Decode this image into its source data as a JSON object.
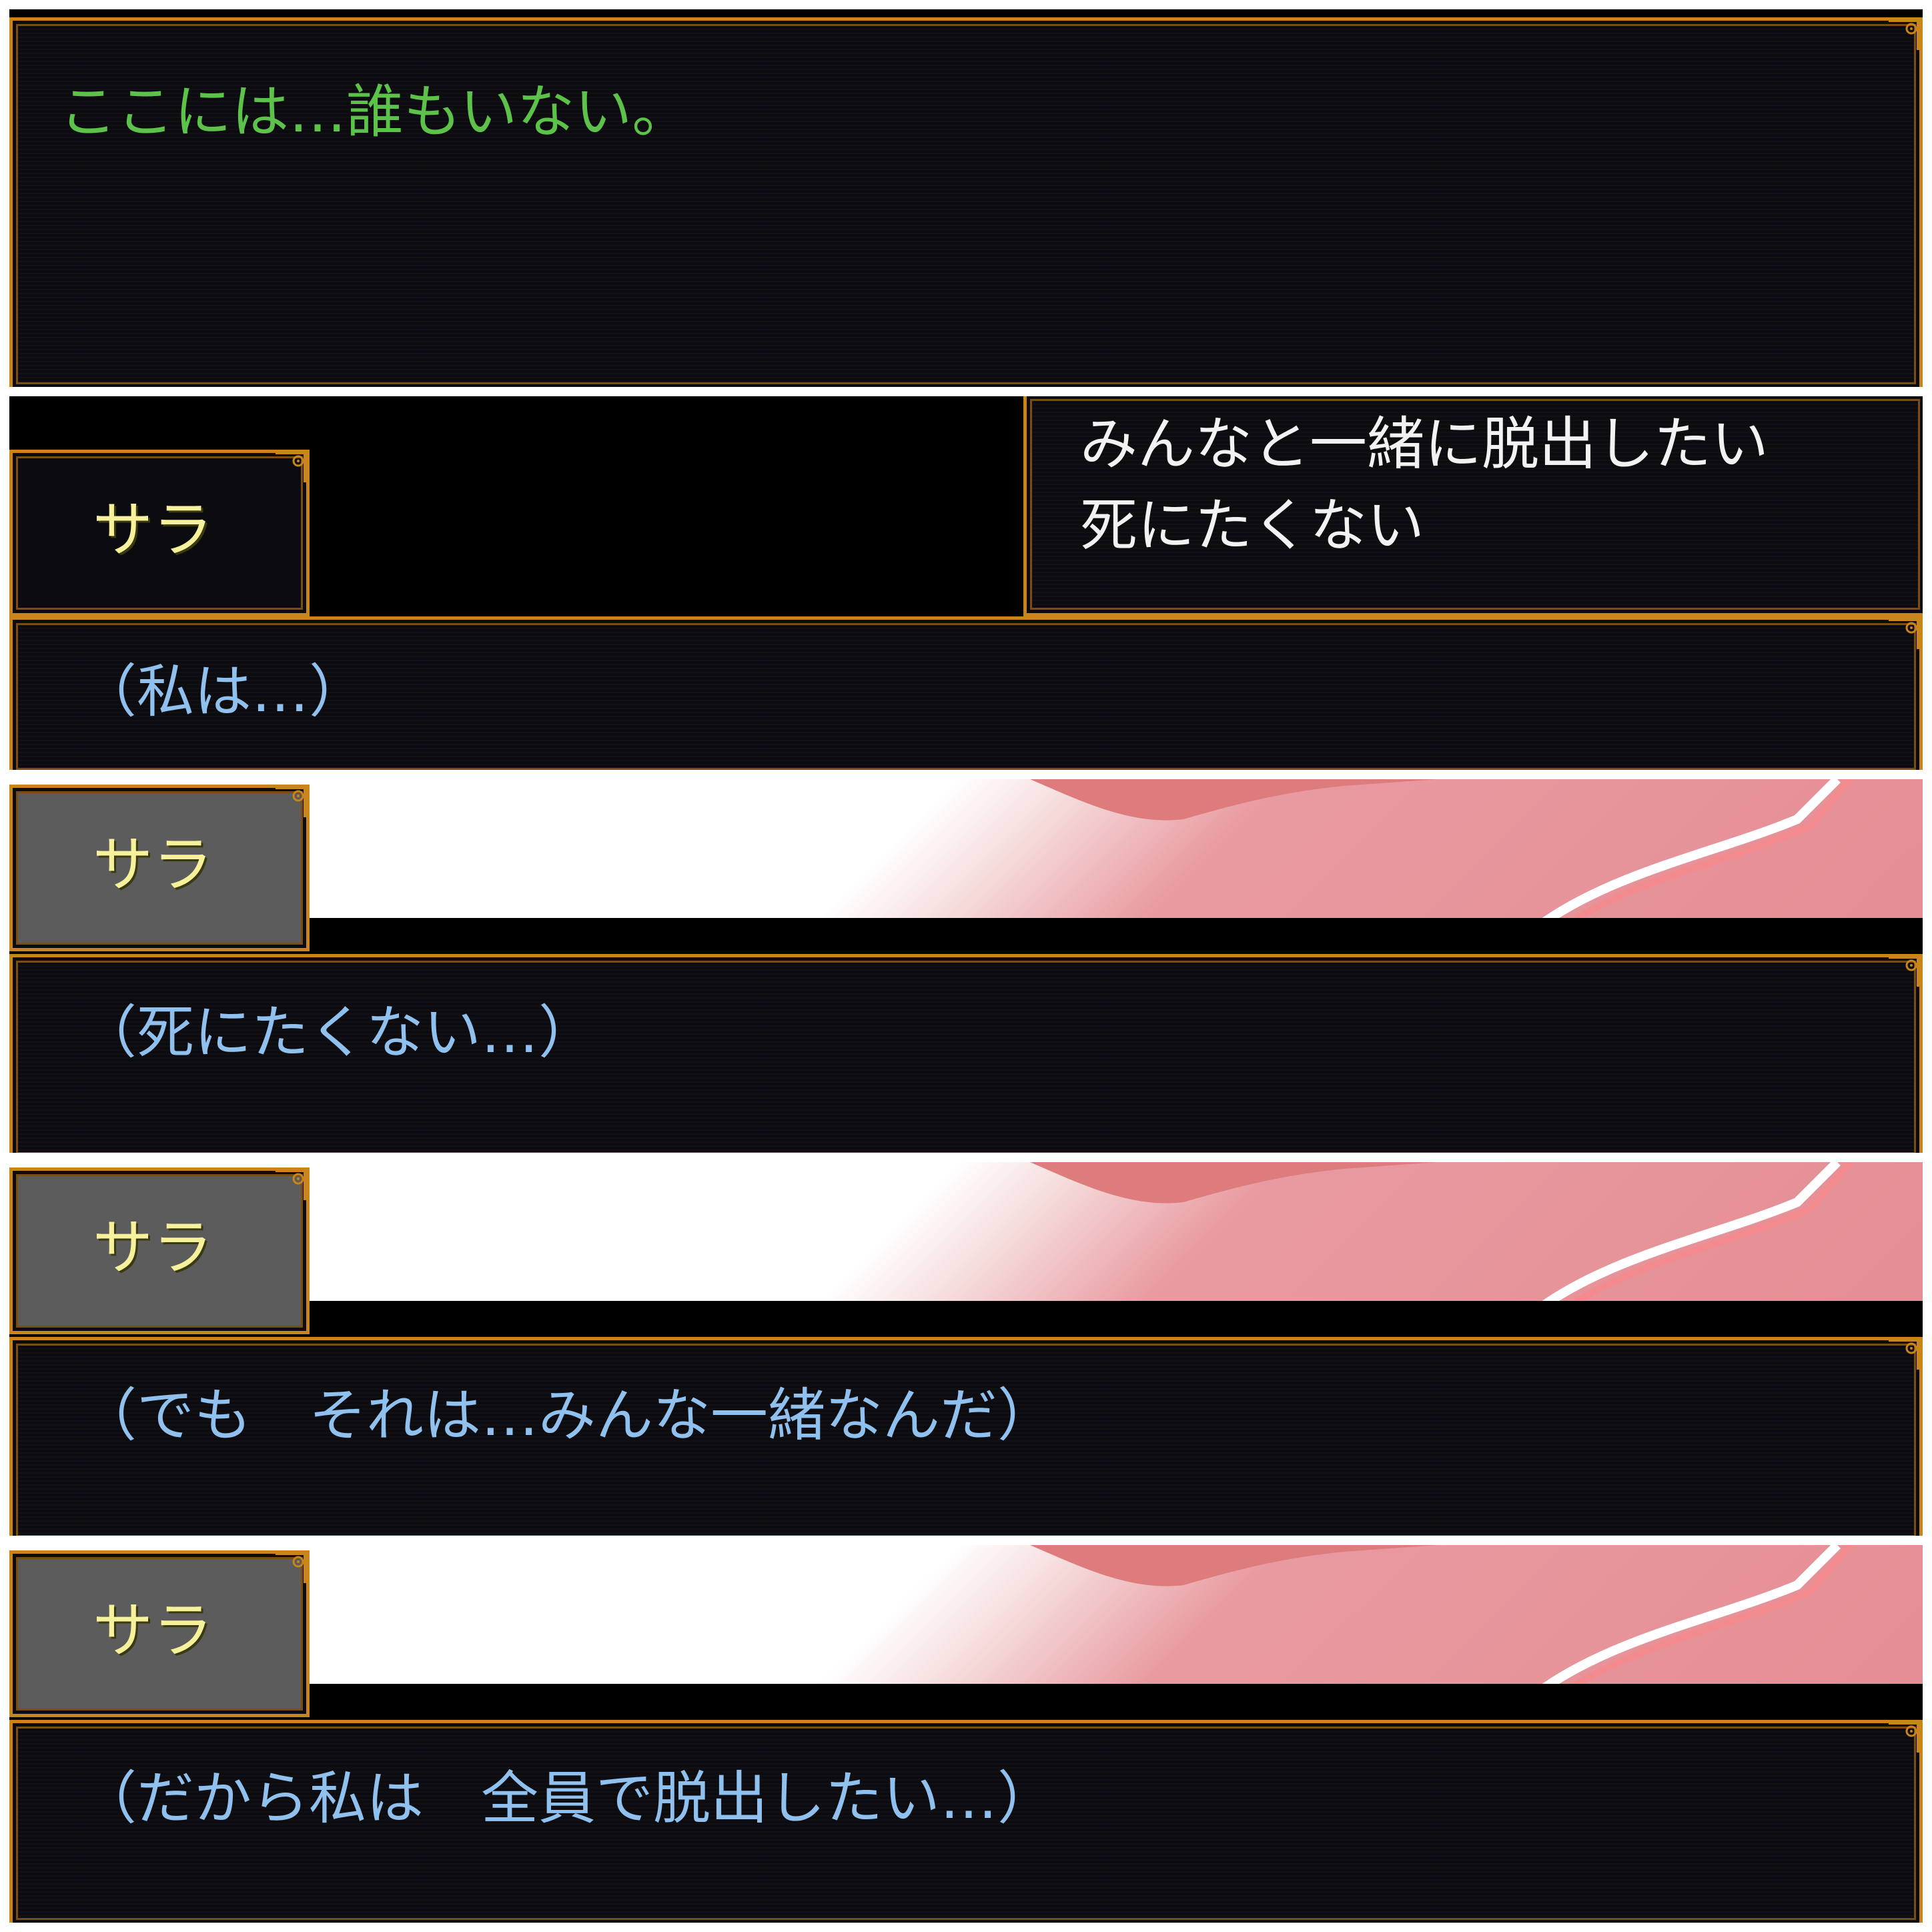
{
  "panels": [
    {
      "type": "narration",
      "text": "ここには…誰もいない。"
    },
    {
      "type": "choice",
      "speaker": "サラ",
      "choices": [
        "みんなと一緒に脱出したい",
        "死にたくない"
      ],
      "dialogue": "（私は…）"
    },
    {
      "type": "dialogue",
      "speaker": "サラ",
      "dialogue": "（死にたくない…）"
    },
    {
      "type": "dialogue",
      "speaker": "サラ",
      "dialogue": "（でも　それは…みんな一緒なんだ）"
    },
    {
      "type": "dialogue",
      "speaker": "サラ",
      "dialogue": "（だから私は　全員で脱出したい…）"
    }
  ],
  "colors": {
    "frame": "#c9851a",
    "narration_text": "#5cc24a",
    "thought_text": "#8fc0ee",
    "name_text": "#f6f19a",
    "choice_text": "#f2f2f2"
  }
}
